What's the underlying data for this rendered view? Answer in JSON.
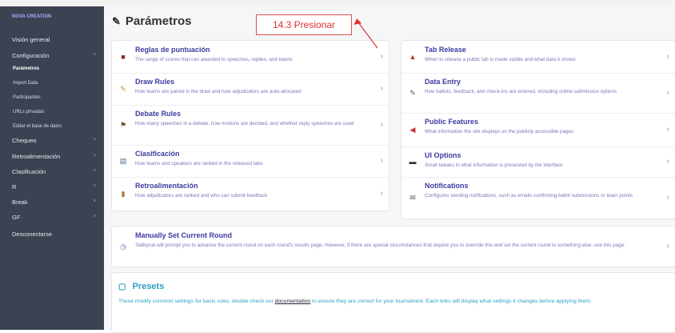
{
  "sidebar": {
    "brand": "NOVA CREATION",
    "items": [
      {
        "label": "Visión general"
      },
      {
        "label": "Configuración",
        "chev": "˅"
      },
      {
        "label": "Chequeo",
        "chev": "˅"
      },
      {
        "label": "Retroalimentación",
        "chev": "˅"
      },
      {
        "label": "Clasificación",
        "chev": "˅"
      },
      {
        "label": "R",
        "chev": "˅"
      },
      {
        "label": "Break",
        "chev": "˅"
      },
      {
        "label": "GF",
        "chev": "˅"
      },
      {
        "label": "Desconectarse"
      }
    ],
    "subitems": [
      {
        "label": "Parámetros"
      },
      {
        "label": "Import Data"
      },
      {
        "label": "Participantes"
      },
      {
        "label": "URLs privadas"
      },
      {
        "label": "Editar el base de datos"
      }
    ]
  },
  "page": {
    "title": "Parámetros",
    "callout": "14.3 Presionar"
  },
  "left_settings": [
    {
      "title": "Reglas de puntuación",
      "desc": "The range of scores that can awarded to speeches, replies, and teams",
      "icon": "trophy-icon",
      "glyph": "■",
      "color": "#8b2a2a"
    },
    {
      "title": "Draw Rules",
      "desc": "How teams are paired in the draw and how adjudicators are auto-allocated",
      "icon": "pencil-icon",
      "glyph": "✎",
      "color": "#c88a2a"
    },
    {
      "title": "Debate Rules",
      "desc": "How many speeches in a debate, how motions are decided, and whether reply speeches are used",
      "icon": "gavel-icon",
      "glyph": "⚑",
      "color": "#6a4a2a"
    },
    {
      "title": "Clasificación",
      "desc": "How teams and speakers are ranked in the released tabs",
      "icon": "chart-icon",
      "glyph": "▤",
      "color": "#4a6a8a"
    },
    {
      "title": "Retroalimentación",
      "desc": "How adjudicators are ranked and who can submit feedback",
      "icon": "clipboard-icon",
      "glyph": "▮",
      "color": "#b07a3a"
    }
  ],
  "right_settings": [
    {
      "title": "Tab Release",
      "desc": "When to release a public tab is made visible and what data it shows",
      "icon": "bell-icon",
      "glyph": "▲",
      "color": "#c03030"
    },
    {
      "title": "Data Entry",
      "desc": "How ballots, feedback, and check-ins are entered, including online submission options",
      "icon": "edit-icon",
      "glyph": "✎",
      "color": "#555"
    },
    {
      "title": "Public Features",
      "desc": "What information the site displays on the publicly accessible pages",
      "icon": "megaphone-icon",
      "glyph": "◀",
      "color": "#c03030"
    },
    {
      "title": "UI Options",
      "desc": "Small tweaks in what information is presented by the interface",
      "icon": "monitor-icon",
      "glyph": "▬",
      "color": "#333"
    },
    {
      "title": "Notifications",
      "desc": "Configures sending notifications, such as emails confirming ballot submissions or team points",
      "icon": "envelope-icon",
      "glyph": "✉",
      "color": "#555"
    }
  ],
  "manual_round": {
    "title": "Manually Set Current Round",
    "desc": "Tabbycat will prompt you to advance the current round on each round's results page. However, if there are special circumstances that require you to override this and set the current round to something else, use this page."
  },
  "presets": {
    "title": "Presets",
    "desc_before": "These modify common settings for basic rules; double check our ",
    "link": "documentation",
    "desc_after": " to ensure they are correct for your tournament. Each links will display what settings it changes before applying them."
  },
  "arrow_glyph": "›"
}
